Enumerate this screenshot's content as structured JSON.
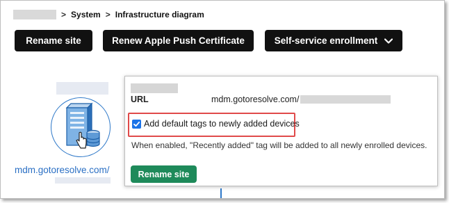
{
  "breadcrumb": {
    "items": [
      "System",
      "Infrastructure diagram"
    ],
    "separator": ">"
  },
  "toolbar": {
    "rename_label": "Rename site",
    "renew_label": "Renew Apple Push Certificate",
    "self_service_label": "Self-service enrollment",
    "self_service_icon": "chevron-down-icon"
  },
  "diagram": {
    "node_icon": "server-icon",
    "node_link": "mdm.gotoresolve.com/"
  },
  "popover": {
    "url_label": "URL",
    "url_value": "mdm.gotoresolve.com/",
    "checkbox_label": "Add default tags to newly added devices",
    "checkbox_checked": true,
    "help_text": "When enabled, \"Recently added\" tag will be added to all newly enrolled devices.",
    "rename_button": "Rename site"
  },
  "colors": {
    "dark_button": "#111111",
    "green_button": "#1e8a5a",
    "link": "#2a6fc4",
    "highlight_border": "#e04a4a",
    "checkbox": "#1a73e8",
    "node_accent": "#2c77c8"
  }
}
